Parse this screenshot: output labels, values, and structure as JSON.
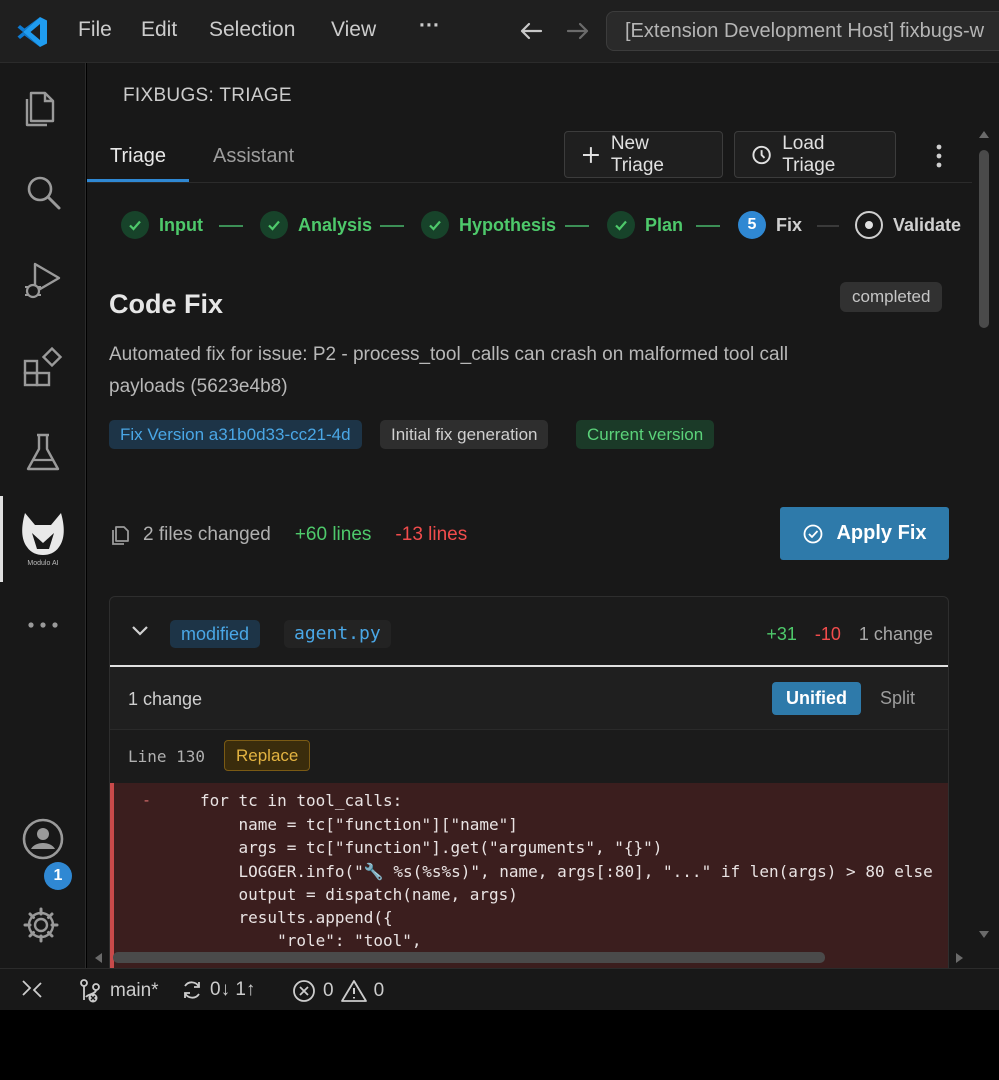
{
  "titlebar": {
    "menu": [
      "File",
      "Edit",
      "Selection",
      "View",
      "···"
    ],
    "command_center": "[Extension Development Host] fixbugs-w"
  },
  "activity": {
    "items": [
      "explorer-icon",
      "search-icon",
      "run-debug-icon",
      "extensions-icon",
      "testing-icon",
      "module-ai-icon",
      "more-icon",
      "account-icon",
      "settings-icon"
    ],
    "modulo_caption": "Modulo AI",
    "settings_badge": "1"
  },
  "panel": {
    "header": "FIXBUGS: TRIAGE",
    "tabs": [
      "Triage",
      "Assistant"
    ],
    "new_triage": "New Triage",
    "load_triage": "Load Triage"
  },
  "stepper": {
    "steps": [
      {
        "label": "Input",
        "state": "done"
      },
      {
        "label": "Analysis",
        "state": "done"
      },
      {
        "label": "Hypothesis",
        "state": "done"
      },
      {
        "label": "Plan",
        "state": "done"
      },
      {
        "label": "Fix",
        "state": "current",
        "number": "5"
      },
      {
        "label": "Validate",
        "state": "pending"
      }
    ]
  },
  "fix": {
    "title": "Code Fix",
    "status": "completed",
    "description": "Automated fix for issue: P2 - process_tool_calls can crash on malformed tool call payloads (5623e4b8)",
    "chips": {
      "version": "Fix Version a31b0d33-cc21-4d",
      "generation": "Initial fix generation",
      "current": "Current version"
    },
    "stats": {
      "files_changed": "2 files changed",
      "added": "+60 lines",
      "removed": "-13 lines"
    },
    "apply_label": "Apply Fix"
  },
  "diff": {
    "status_tag": "modified",
    "filename": "agent.py",
    "added": "+31",
    "removed": "-10",
    "changes": "1 change",
    "change_bar_label": "1 change",
    "view_unified": "Unified",
    "view_split": "Split",
    "line_label": "Line 130",
    "op": "Replace",
    "marker": "-",
    "code_lines": [
      "for tc in tool_calls:",
      "    name = tc[\"function\"][\"name\"]",
      "    args = tc[\"function\"].get(\"arguments\", \"{}\")",
      "    LOGGER.info(\"🔧 %s(%s%s)\", name, args[:80], \"...\" if len(args) > 80 else",
      "    output = dispatch(name, args)",
      "    results.append({",
      "        \"role\": \"tool\","
    ]
  },
  "statusbar": {
    "branch": "main*",
    "sync": "0↓ 1↑",
    "errors": "0",
    "warnings": "0"
  },
  "colors": {
    "accent": "#2f88d3",
    "added": "#4ec96b",
    "removed": "#f14c4c",
    "removed_bg": "#3b1e1e"
  }
}
